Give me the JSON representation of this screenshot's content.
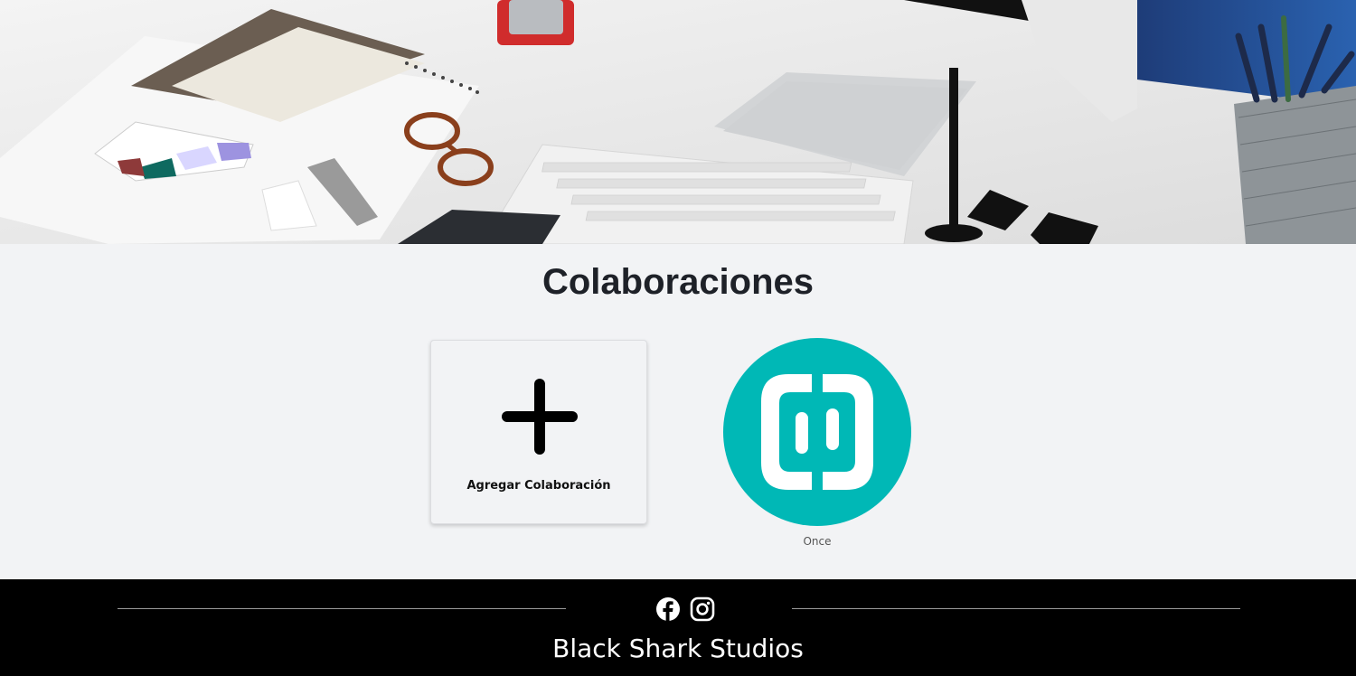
{
  "hero": {
    "image": "desk-workspace-photo"
  },
  "main": {
    "title": "Colaboraciones",
    "add_card": {
      "label": "Agregar Colaboración",
      "icon": "plus-icon"
    },
    "collaborations": [
      {
        "name": "Once",
        "logo": "once-logo",
        "color": "#00b8b6"
      }
    ]
  },
  "footer": {
    "social": [
      {
        "name": "Facebook",
        "icon": "facebook-icon"
      },
      {
        "name": "Instagram",
        "icon": "instagram-icon"
      }
    ],
    "brand": "Black Shark Studios"
  },
  "colors": {
    "background": "#f2f3f5",
    "title": "#1e2128",
    "footer_bg": "#000000",
    "accent": "#00b8b6"
  }
}
